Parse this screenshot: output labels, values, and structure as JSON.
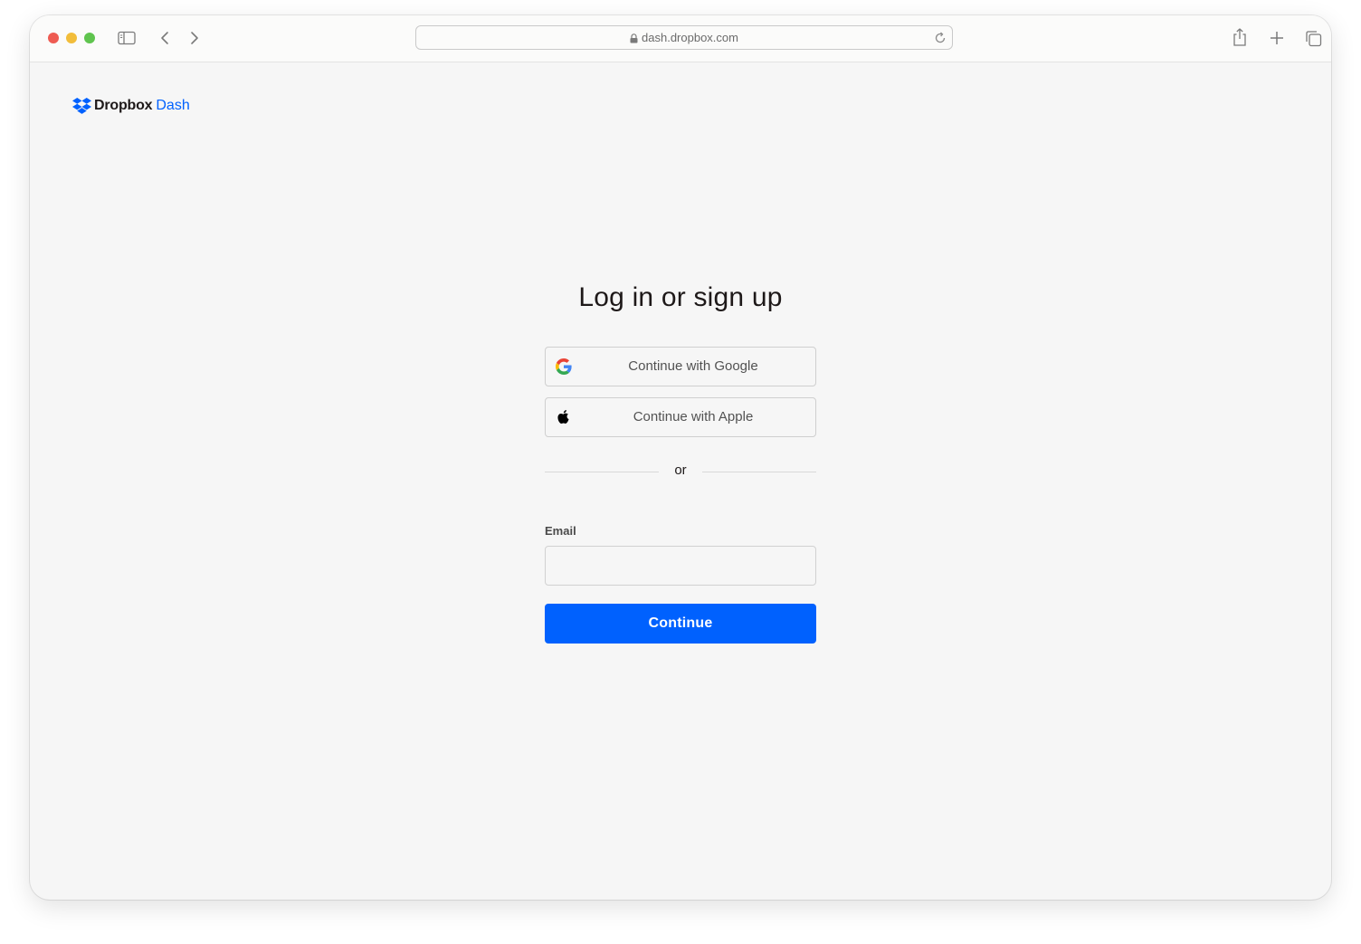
{
  "browser": {
    "url": "dash.dropbox.com"
  },
  "logo": {
    "name": "Dropbox",
    "product": "Dash"
  },
  "auth": {
    "title": "Log in or sign up",
    "google_label": "Continue with Google",
    "apple_label": "Continue with Apple",
    "divider": "or",
    "email_label": "Email",
    "email_value": "",
    "continue_label": "Continue"
  },
  "colors": {
    "brand_blue": "#0061fe",
    "background": "#f6f6f6",
    "text": "#1e1919"
  }
}
